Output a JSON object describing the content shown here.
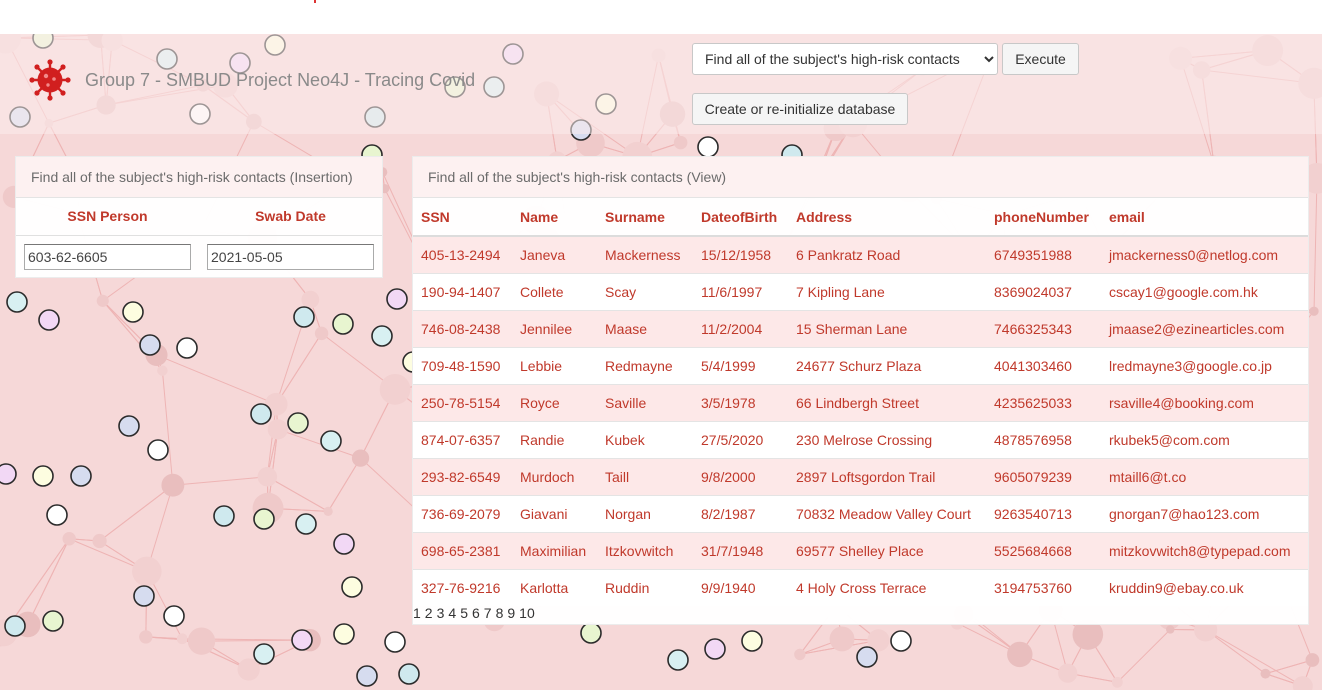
{
  "header": {
    "title": "Group 7 - SMBUD Project Neo4J - Tracing Covid",
    "logo_icon": "virus-icon",
    "query_select_value": "Find all of the subject's high-risk contacts",
    "query_options": [
      "Find all of the subject's high-risk contacts"
    ],
    "execute_label": "Execute",
    "init_label": "Create or re-initialize database"
  },
  "insertion": {
    "title": "Find all of the subject's high-risk contacts (Insertion)",
    "col_ssn": "SSN Person",
    "col_date": "Swab Date",
    "ssn_value": "603-62-6605",
    "date_value": "2021-05-05"
  },
  "view": {
    "title": "Find all of the subject's high-risk contacts (View)",
    "columns": [
      "SSN",
      "Name",
      "Surname",
      "DateofBirth",
      "Address",
      "phoneNumber",
      "email"
    ],
    "rows": [
      [
        "405-13-2494",
        "Janeva",
        "Mackerness",
        "15/12/1958",
        "6 Pankratz Road",
        "6749351988",
        "jmackerness0@netlog.com"
      ],
      [
        "190-94-1407",
        "Collete",
        "Scay",
        "11/6/1997",
        "7 Kipling Lane",
        "8369024037",
        "cscay1@google.com.hk"
      ],
      [
        "746-08-2438",
        "Jennilee",
        "Maase",
        "11/2/2004",
        "15 Sherman Lane",
        "7466325343",
        "jmaase2@ezinearticles.com"
      ],
      [
        "709-48-1590",
        "Lebbie",
        "Redmayne",
        "5/4/1999",
        "24677 Schurz Plaza",
        "4041303460",
        "lredmayne3@google.co.jp"
      ],
      [
        "250-78-5154",
        "Royce",
        "Saville",
        "3/5/1978",
        "66 Lindbergh Street",
        "4235625033",
        "rsaville4@booking.com"
      ],
      [
        "874-07-6357",
        "Randie",
        "Kubek",
        "27/5/2020",
        "230 Melrose Crossing",
        "4878576958",
        "rkubek5@com.com"
      ],
      [
        "293-82-6549",
        "Murdoch",
        "Taill",
        "9/8/2000",
        "2897 Loftsgordon Trail",
        "9605079239",
        "mtaill6@t.co"
      ],
      [
        "736-69-2079",
        "Giavani",
        "Norgan",
        "8/2/1987",
        "70832 Meadow Valley Court",
        "9263540713",
        "gnorgan7@hao123.com"
      ],
      [
        "698-65-2381",
        "Maximilian",
        "Itzkovwitch",
        "31/7/1948",
        "69577 Shelley Place",
        "5525684668",
        "mitzkovwitch8@typepad.com"
      ],
      [
        "327-76-9216",
        "Karlotta",
        "Ruddin",
        "9/9/1940",
        "4 Holy Cross Terrace",
        "3194753760",
        "kruddin9@ebay.co.uk"
      ]
    ],
    "pages": [
      "1",
      "2",
      "3",
      "4",
      "5",
      "6",
      "7",
      "8",
      "9",
      "10"
    ]
  },
  "colors": {
    "accent": "#c0392b",
    "background": "#f6d8d8",
    "row_alt": "#fde8e8"
  }
}
